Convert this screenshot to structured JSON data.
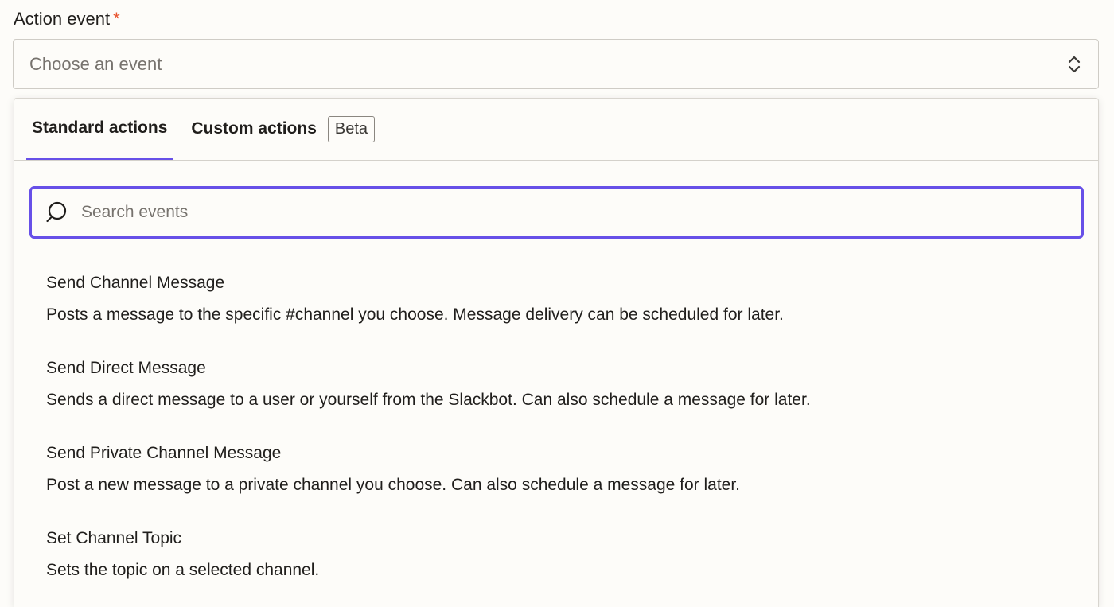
{
  "field": {
    "label": "Action event",
    "required_mark": "*",
    "placeholder": "Choose an event",
    "chevron_icon": "chevron-up-down-icon"
  },
  "tabs": [
    {
      "label": "Standard actions",
      "active": true
    },
    {
      "label": "Custom actions",
      "active": false,
      "badge": "Beta"
    }
  ],
  "search": {
    "placeholder": "Search events",
    "icon": "search-icon"
  },
  "events": [
    {
      "title": "Send Channel Message",
      "description": "Posts a message to the specific #channel you choose. Message delivery can be scheduled for later."
    },
    {
      "title": "Send Direct Message",
      "description": "Sends a direct message to a user or yourself from the Slackbot. Can also schedule a message for later."
    },
    {
      "title": "Send Private Channel Message",
      "description": "Post a new message to a private channel you choose. Can also schedule a message for later."
    },
    {
      "title": "Set Channel Topic",
      "description": "Sets the topic on a selected channel."
    }
  ],
  "colors": {
    "accent": "#6750e8",
    "required": "#e8532e",
    "background": "#fdfcf9"
  }
}
